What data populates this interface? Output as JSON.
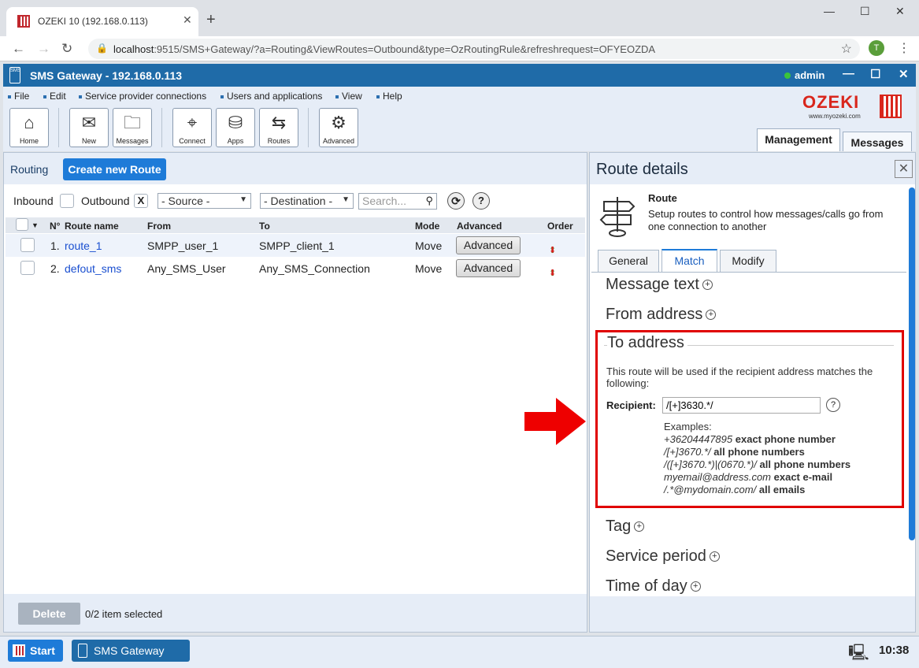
{
  "browser": {
    "tab_title": "OZEKI 10 (192.168.0.113)",
    "url_host": "localhost",
    "url_rest": ":9515/SMS+Gateway/?a=Routing&ViewRoutes=Outbound&type=OzRoutingRule&refreshrequest=OFYEOZDA",
    "avatar_letter": "T"
  },
  "app": {
    "title": "SMS Gateway - 192.168.0.113",
    "user": "admin",
    "status_color": "#3bc43b"
  },
  "menu": [
    "File",
    "Edit",
    "Service provider connections",
    "Users and applications",
    "View",
    "Help"
  ],
  "toolbar": {
    "home": "Home",
    "new": "New",
    "messages": "Messages",
    "connect": "Connect",
    "apps": "Apps",
    "routes": "Routes",
    "advanced": "Advanced"
  },
  "brand": {
    "logo_text": "OZEKI",
    "site": "www.myozeki.com"
  },
  "main_tabs": [
    "Management",
    "Messages"
  ],
  "routing": {
    "label": "Routing",
    "create_button": "Create new Route",
    "inbound_label": "Inbound",
    "outbound_label": "Outbound",
    "outbound_mark": "X",
    "source_select": "- Source -",
    "destination_select": "- Destination -",
    "search_placeholder": "Search...",
    "help": "?",
    "columns": [
      "N°",
      "Route name",
      "From",
      "To",
      "Mode",
      "Advanced",
      "Order"
    ],
    "rows": [
      {
        "num": "1.",
        "name": "route_1",
        "from": "SMPP_user_1",
        "to": "SMPP_client_1",
        "mode": "Move",
        "advanced": "Advanced"
      },
      {
        "num": "2.",
        "name": "defout_sms",
        "from": "Any_SMS_User",
        "to": "Any_SMS_Connection",
        "mode": "Move",
        "advanced": "Advanced"
      }
    ],
    "delete_button": "Delete",
    "selection_info": "0/2 item selected"
  },
  "details": {
    "title": "Route details",
    "route_heading": "Route",
    "route_description": "Setup routes to control how messages/calls go from one connection to another",
    "tabs": [
      "General",
      "Match",
      "Modify"
    ],
    "active_tab": "Match",
    "sections": {
      "message_text": "Message text",
      "from_address": "From address",
      "to_address": "To address",
      "tag": "Tag",
      "service_period": "Service period",
      "time_of_day": "Time of day"
    },
    "to_address_info": "This route will be used if the recipient address matches the following:",
    "recipient_label": "Recipient:",
    "recipient_value": "/[+]3630.*/",
    "examples_label": "Examples:",
    "examples": [
      {
        "pattern": "+36204447895",
        "desc": "exact phone number"
      },
      {
        "pattern": "/[+]3670.*/",
        "desc": "all phone numbers"
      },
      {
        "pattern": "/([+]3670.*)|(0670.*)/",
        "desc": "all phone numbers"
      },
      {
        "pattern": "myemail@address.com",
        "desc": "exact e-mail"
      },
      {
        "pattern": "/.*@mydomain.com/",
        "desc": "all emails"
      }
    ]
  },
  "taskbar": {
    "start": "Start",
    "app": "SMS Gateway",
    "clock": "10:38"
  },
  "colors": {
    "accent": "#1e7bd8",
    "highlight_box": "#e00000",
    "arrow": "#ee0000"
  }
}
